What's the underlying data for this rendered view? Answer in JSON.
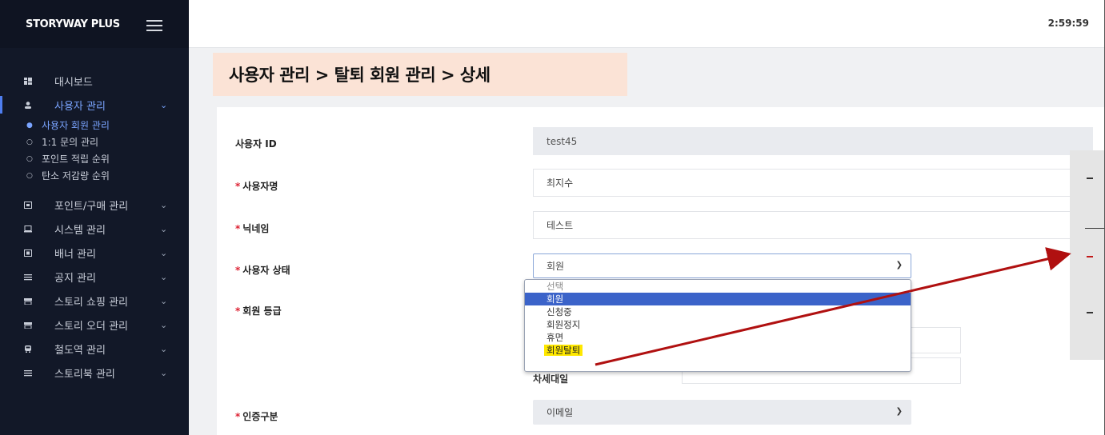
{
  "sidebar": {
    "brand": "STORYWAY PLUS",
    "dashboard": "대시보드",
    "user_mgmt": "사용자 관리",
    "sub_items": [
      "사용자 회원 관리",
      "1:1 문의 관리",
      "포인트 적립 순위",
      "탄소 저감량 순위"
    ],
    "groups": [
      "포인트/구매 관리",
      "시스템 관리",
      "배너 관리",
      "공지 관리",
      "스토리 쇼핑 관리",
      "스토리 오더 관리",
      "철도역 관리",
      "스토리북 관리"
    ]
  },
  "header": {
    "time": "2:59:59"
  },
  "page": {
    "title": "사용자 관리 > 탈퇴 회원 관리 > 상세"
  },
  "form": {
    "user_id_label": "사용자 ID",
    "user_id_value": "test45",
    "name_label": "사용자명",
    "name_value": "최지수",
    "nickname_label": "닉네임",
    "nickname_value": "테스트",
    "status_label": "사용자 상태",
    "status_value": "회원",
    "grade_label": "회원 등급",
    "behind_text": "차세대일",
    "auth_label": "인증구분",
    "auth_value": "이메일",
    "required_mark": "*"
  },
  "dropdown": {
    "options": [
      "선택",
      "회원",
      "신청중",
      "회원정지",
      "휴면",
      "회원탈퇴"
    ],
    "selected_index": 1,
    "highlighted_index": 5
  },
  "colors": {
    "sidebar_bg": "#121828",
    "accent": "#3b63c9",
    "title_bg": "#fbe3d6",
    "arrow": "#b01010",
    "highlight": "#ffe800"
  }
}
